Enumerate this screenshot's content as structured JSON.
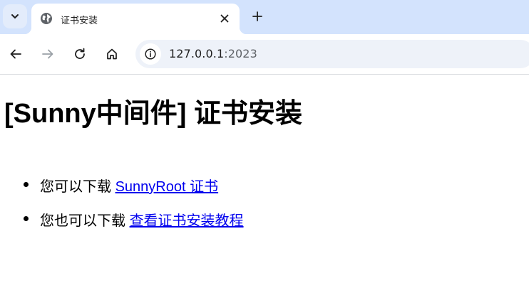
{
  "browser": {
    "tab": {
      "title": "证书安装",
      "favicon": "globe-icon"
    },
    "toolbar": {
      "url_host": "127.0.0.1",
      "url_port": ":2023"
    },
    "icons": {
      "tab_search": "chevron-down-icon",
      "close": "close-icon",
      "new_tab": "plus-icon",
      "back": "arrow-left-icon",
      "forward": "arrow-right-icon",
      "reload": "reload-icon",
      "home": "home-icon",
      "site_info": "info-icon"
    },
    "colors": {
      "tabstrip_bg": "#d3e3fd",
      "omnibox_bg": "#eef2f9",
      "link": "#0000ee"
    }
  },
  "page": {
    "title": "[Sunny中间件] 证书安装",
    "items": [
      {
        "text": "您可以下载",
        "link_text": "SunnyRoot 证书"
      },
      {
        "text": "您也可以下载",
        "link_text": "查看证书安装教程"
      }
    ]
  }
}
